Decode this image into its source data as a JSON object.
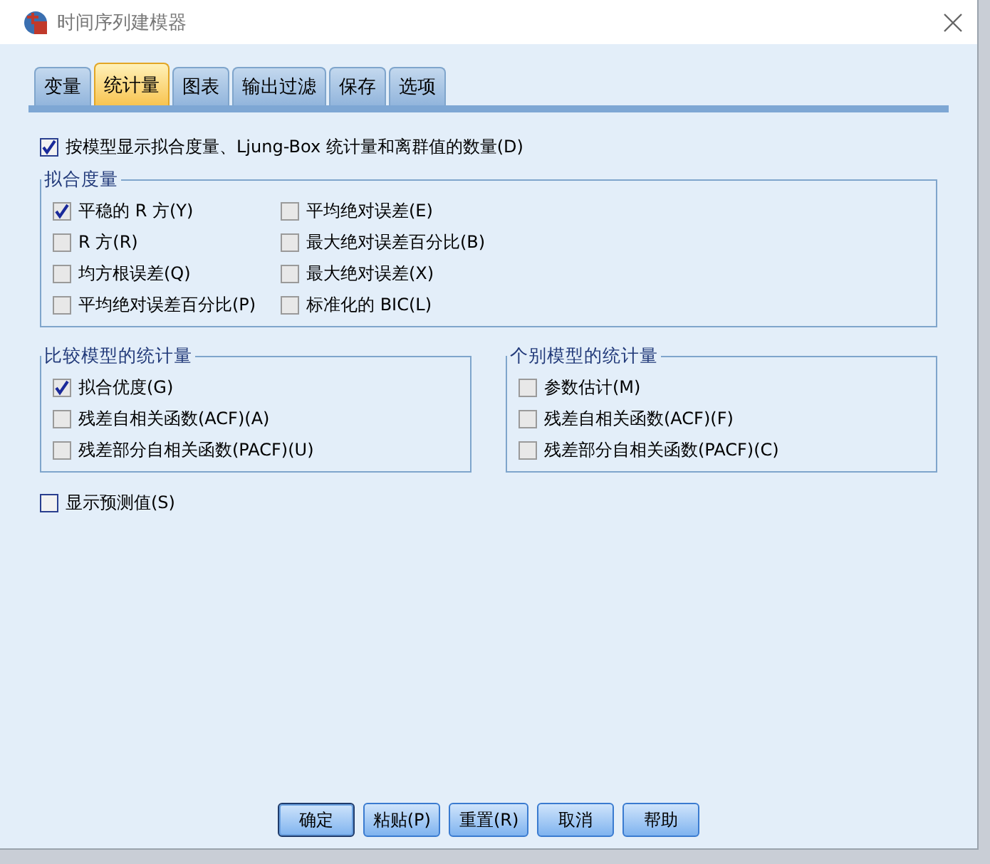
{
  "window": {
    "title": "时间序列建模器"
  },
  "tabs": [
    {
      "label": "变量",
      "selected": false
    },
    {
      "label": "统计量",
      "selected": true
    },
    {
      "label": "图表",
      "selected": false
    },
    {
      "label": "输出过滤",
      "selected": false
    },
    {
      "label": "保存",
      "selected": false
    },
    {
      "label": "选项",
      "selected": false
    }
  ],
  "main_option": {
    "label": "按模型显示拟合度量、Ljung-Box 统计量和离群值的数量(D)",
    "checked": true
  },
  "fit_measures": {
    "title": "拟合度量",
    "columns": [
      [
        {
          "label": "平稳的 R 方(Y)",
          "checked": true
        },
        {
          "label": "R 方(R)",
          "checked": false
        },
        {
          "label": "均方根误差(Q)",
          "checked": false
        },
        {
          "label": "平均绝对误差百分比(P)",
          "checked": false
        }
      ],
      [
        {
          "label": "平均绝对误差(E)",
          "checked": false
        },
        {
          "label": "最大绝对误差百分比(B)",
          "checked": false
        },
        {
          "label": "最大绝对误差(X)",
          "checked": false
        },
        {
          "label": "标准化的 BIC(L)",
          "checked": false
        }
      ]
    ]
  },
  "groups": [
    {
      "title": "比较模型的统计量",
      "items": [
        {
          "label": "拟合优度(G)",
          "checked": true
        },
        {
          "label": "残差自相关函数(ACF)(A)",
          "checked": false
        },
        {
          "label": "残差部分自相关函数(PACF)(U)",
          "checked": false
        }
      ]
    },
    {
      "title": "个别模型的统计量",
      "items": [
        {
          "label": "参数估计(M)",
          "checked": false
        },
        {
          "label": "残差自相关函数(ACF)(F)",
          "checked": false
        },
        {
          "label": "残差部分自相关函数(PACF)(C)",
          "checked": false
        }
      ]
    }
  ],
  "show_predictions": {
    "label": "显示预测值(S)",
    "checked": false
  },
  "buttons": [
    {
      "label": "确定",
      "default": true
    },
    {
      "label": "粘贴(P)",
      "default": false
    },
    {
      "label": "重置(R)",
      "default": false
    },
    {
      "label": "取消",
      "default": false
    },
    {
      "label": "帮助",
      "default": false
    }
  ]
}
